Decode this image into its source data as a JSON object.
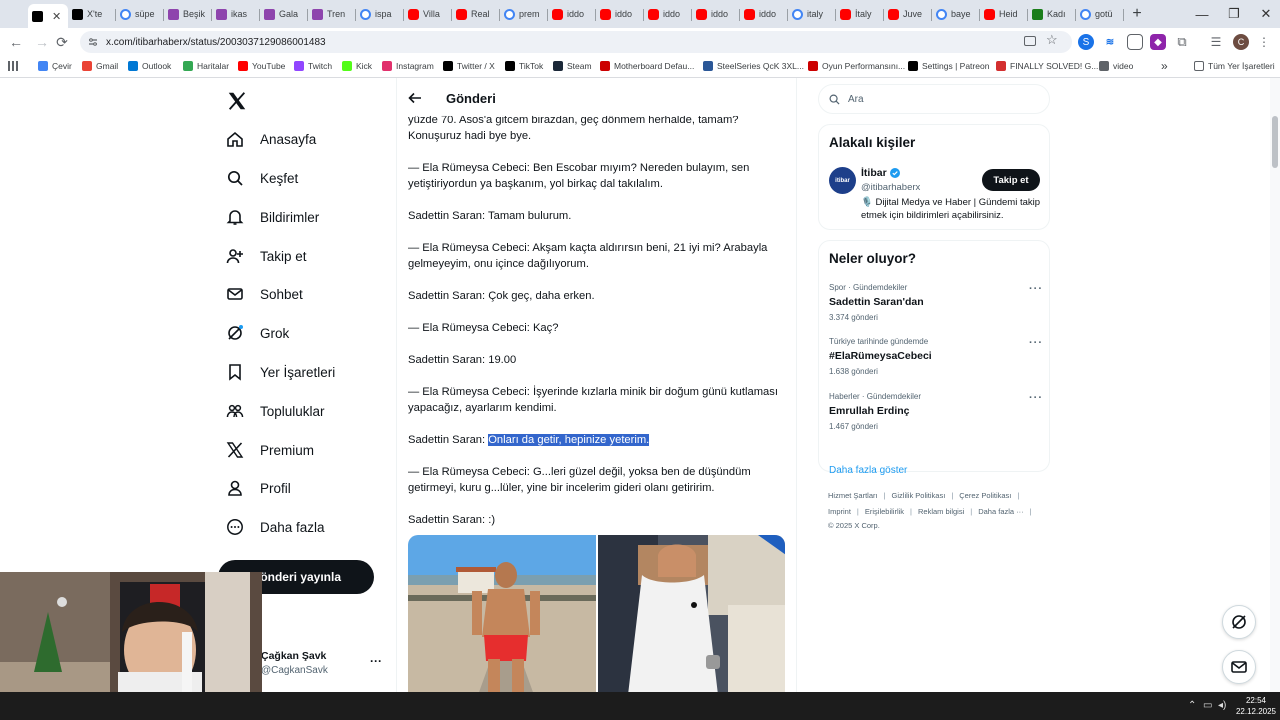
{
  "browser": {
    "tabs": [
      {
        "title": "",
        "icon": "x-icon",
        "active": true
      },
      {
        "title": "X'te",
        "icon": "x-icon"
      },
      {
        "title": "süpe",
        "icon": "google-icon"
      },
      {
        "title": "Beşik",
        "icon": "image-icon"
      },
      {
        "title": "ikas",
        "icon": "image-icon"
      },
      {
        "title": "Gala",
        "icon": "image-icon"
      },
      {
        "title": "Tren",
        "icon": "image-icon"
      },
      {
        "title": "ispa",
        "icon": "google-icon"
      },
      {
        "title": "Villa",
        "icon": "youtube-icon"
      },
      {
        "title": "Real",
        "icon": "youtube-icon"
      },
      {
        "title": "prem",
        "icon": "google-icon"
      },
      {
        "title": "iddo",
        "icon": "youtube-icon"
      },
      {
        "title": "iddo",
        "icon": "youtube-icon"
      },
      {
        "title": "iddo",
        "icon": "youtube-icon"
      },
      {
        "title": "iddo",
        "icon": "youtube-icon"
      },
      {
        "title": "iddo",
        "icon": "youtube-icon"
      },
      {
        "title": "italy",
        "icon": "google-icon"
      },
      {
        "title": "İtaly",
        "icon": "youtube-icon"
      },
      {
        "title": "Juve",
        "icon": "youtube-icon"
      },
      {
        "title": "baye",
        "icon": "google-icon"
      },
      {
        "title": "Heid",
        "icon": "youtube-icon"
      },
      {
        "title": "Kadı",
        "icon": "kick-icon"
      },
      {
        "title": "gotü",
        "icon": "google-icon"
      }
    ],
    "url": "x.com/itibarhaberx/status/2003037129086001483",
    "bookmarks": [
      {
        "label": "Çevir",
        "color": "#4285f4"
      },
      {
        "label": "Gmail",
        "color": "#ea4335"
      },
      {
        "label": "Outlook",
        "color": "#0078d4"
      },
      {
        "label": "Haritalar",
        "color": "#34a853"
      },
      {
        "label": "YouTube",
        "color": "#ff0000"
      },
      {
        "label": "Twitch",
        "color": "#9146ff"
      },
      {
        "label": "Kick",
        "color": "#53fc18"
      },
      {
        "label": "Instagram",
        "color": "#e1306c"
      },
      {
        "label": "Twitter / X",
        "color": "#000000"
      },
      {
        "label": "TikTok",
        "color": "#000000"
      },
      {
        "label": "Steam",
        "color": "#1b2838"
      },
      {
        "label": "Motherboard Defau...",
        "color": "#cc0000"
      },
      {
        "label": "SteelSeries QcK 3XL...",
        "color": "#2b5797"
      },
      {
        "label": "Oyun Performansını...",
        "color": "#cc0000"
      },
      {
        "label": "Settings | Patreon",
        "color": "#000000"
      },
      {
        "label": "FINALLY SOLVED! G...",
        "color": "#d32f2f"
      },
      {
        "label": "video",
        "color": "#5f6368"
      }
    ],
    "bookmarks_more": "»",
    "all_bookmarks": "Tüm Yer İşaretleri"
  },
  "nav": {
    "items": [
      {
        "label": "Anasayfa",
        "icon": "home-icon"
      },
      {
        "label": "Keşfet",
        "icon": "search-icon"
      },
      {
        "label": "Bildirimler",
        "icon": "bell-icon"
      },
      {
        "label": "Takip et",
        "icon": "add-user-icon"
      },
      {
        "label": "Sohbet",
        "icon": "mail-icon"
      },
      {
        "label": "Grok",
        "icon": "grok-icon"
      },
      {
        "label": "Yer İşaretleri",
        "icon": "bookmark-icon"
      },
      {
        "label": "Topluluklar",
        "icon": "communities-icon"
      },
      {
        "label": "Premium",
        "icon": "x-icon"
      },
      {
        "label": "Profil",
        "icon": "profile-icon"
      },
      {
        "label": "Daha fazla",
        "icon": "more-icon"
      }
    ],
    "post_button": "Gönderi yayınla",
    "account": {
      "name": "Çağkan Şavk",
      "handle": "@CagkanSavk"
    }
  },
  "main": {
    "title": "Gönderi",
    "paragraphs": [
      "yüzde 70. Asos'a gitcem birazdan, geç dönmem herhalde, tamam? Konuşuruz hadi bye bye.",
      "— Ela Rümeysa Cebeci: Ben Escobar mıyım? Nereden bulayım, sen yetiştiriyordun ya başkanım, yol birkaç dal takılalım.",
      "Sadettin Saran: Tamam bulurum.",
      "— Ela Rümeysa Cebeci: Akşam kaçta aldırırsın beni, 21 iyi mi? Arabayla gelmeyeyim, onu içince dağılıyorum.",
      "Sadettin Saran: Çok geç, daha erken.",
      "— Ela Rümeysa Cebeci: Kaç?",
      "Sadettin Saran: 19.00",
      "— Ela Rümeysa Cebeci: İşyerinde kızlarla minik bir doğum günü kutlaması yapacağız, ayarlarım kendimi."
    ],
    "highlight_prefix": "Sadettin Saran: ",
    "highlight_text": "Onları da getir, hepinize yeterim.",
    "paragraphs_after": [
      "— Ela Rümeysa Cebeci: G...leri güzel değil, yoksa ben de düşündüm getirmeyi, kuru g...lüler, yine bir incelerim gideri olanı getiririm.",
      "Sadettin Saran: :)"
    ]
  },
  "right": {
    "search_placeholder": "Ara",
    "relevant_title": "Alakalı kişiler",
    "person": {
      "avatar_text": "itibar",
      "name": "İtibar",
      "handle": "@itibarhaberx",
      "follow_label": "Takip et",
      "bio": "🎙️ Dijital Medya ve Haber | Gündemi takip etmek için bildirimleri açabilirsiniz."
    },
    "trends_title": "Neler oluyor?",
    "trends": [
      {
        "category": "Spor · Gündemdekiler",
        "name": "Sadettin Saran'dan",
        "count": "3.374 gönderi"
      },
      {
        "category": "Türkiye tarihinde gündemde",
        "name": "#ElaRümeysaCebeci",
        "count": "1.638 gönderi"
      },
      {
        "category": "Haberler · Gündemdekiler",
        "name": "Emrullah Erdinç",
        "count": "1.467 gönderi"
      }
    ],
    "trend_more": "···",
    "show_more": "Daha fazla göster",
    "footer": {
      "line1": [
        "Hizmet Şartları",
        "Gizlilik Politikası",
        "Çerez Politikası"
      ],
      "line2": [
        "Imprint",
        "Erişilebilirlik",
        "Reklam bilgisi",
        "Daha fazla ···"
      ],
      "copyright": "© 2025 X Corp."
    }
  },
  "taskbar": {
    "time": "22:54",
    "date": "22.12.2025"
  },
  "colors": {
    "accent": "#1d9bf0",
    "highlight": "#3366cc",
    "dark": "#0f1419"
  }
}
